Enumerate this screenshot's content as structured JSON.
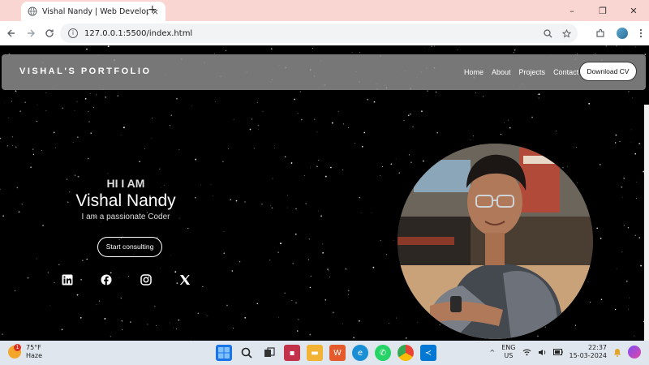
{
  "browser": {
    "tab_title": "Vishal Nandy | Web Developer",
    "tab_close": "×",
    "new_tab": "+",
    "url": "127.0.0.1:5500/index.html",
    "window_controls": [
      "–",
      "❐",
      "✕"
    ]
  },
  "site": {
    "brand": "VISHAL'S PORTFOLIO",
    "nav_links": [
      "Home",
      "About",
      "Projects",
      "Contact"
    ],
    "download_label": "Download CV",
    "greeting": "HI I AM",
    "name": "Vishal Nandy",
    "tagline": "I am a passionate Coder",
    "cta_label": "Start consulting",
    "socials": [
      "linkedin-icon",
      "facebook-icon",
      "instagram-icon",
      "x-icon"
    ]
  },
  "taskbar": {
    "temperature": "75°F",
    "condition": "Haze",
    "weather_badge": "1",
    "lang_top": "ENG",
    "lang_bottom": "US",
    "time": "22:37",
    "date": "15-03-2024"
  },
  "colors": {
    "tabstrip": "#f9d6d2",
    "navbar": "#8c8c8c",
    "page_bg": "#000000"
  }
}
